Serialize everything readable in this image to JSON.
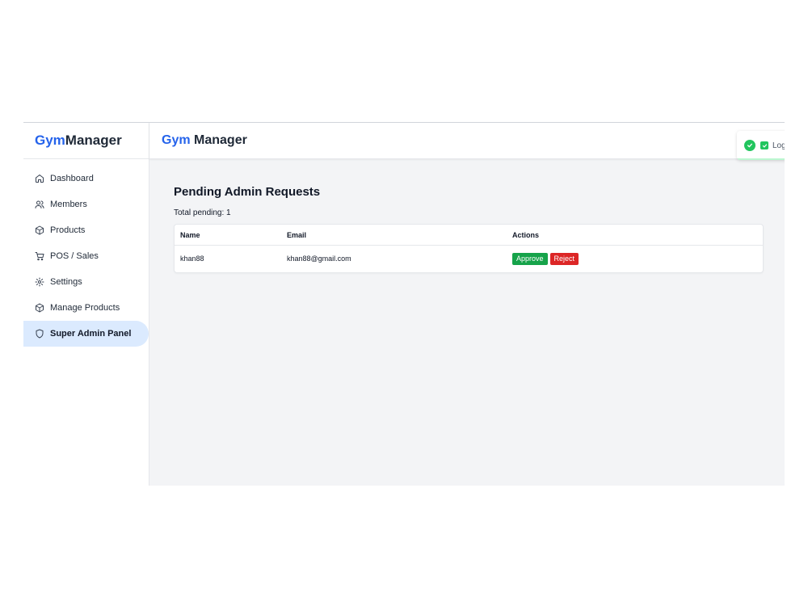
{
  "sidebar": {
    "logo_prefix": "Gym",
    "logo_suffix": "Manager",
    "items": [
      {
        "label": "Dashboard",
        "icon": "home-icon"
      },
      {
        "label": "Members",
        "icon": "users-icon"
      },
      {
        "label": "Products",
        "icon": "package-icon"
      },
      {
        "label": "POS / Sales",
        "icon": "cart-icon"
      },
      {
        "label": "Settings",
        "icon": "gear-icon"
      },
      {
        "label": "Manage Products",
        "icon": "package-icon"
      },
      {
        "label": "Super Admin Panel",
        "icon": "shield-icon",
        "active": true
      }
    ]
  },
  "header": {
    "title_prefix": "Gym",
    "title_suffix": " Manager"
  },
  "toast": {
    "message": "Login successful",
    "close": "×",
    "type": "success"
  },
  "main": {
    "title": "Pending Admin Requests",
    "total_label": "Total pending: 1",
    "table": {
      "columns": [
        "Name",
        "Email",
        "Actions"
      ],
      "rows": [
        {
          "name": "khan88",
          "email": "khan88@gmail.com",
          "approve": "Approve",
          "reject": "Reject"
        }
      ]
    }
  },
  "colors": {
    "accent": "#2563eb",
    "active_bg": "#dbeafe",
    "approve": "#16a34a",
    "reject": "#dc2626",
    "success": "#22c55e"
  }
}
